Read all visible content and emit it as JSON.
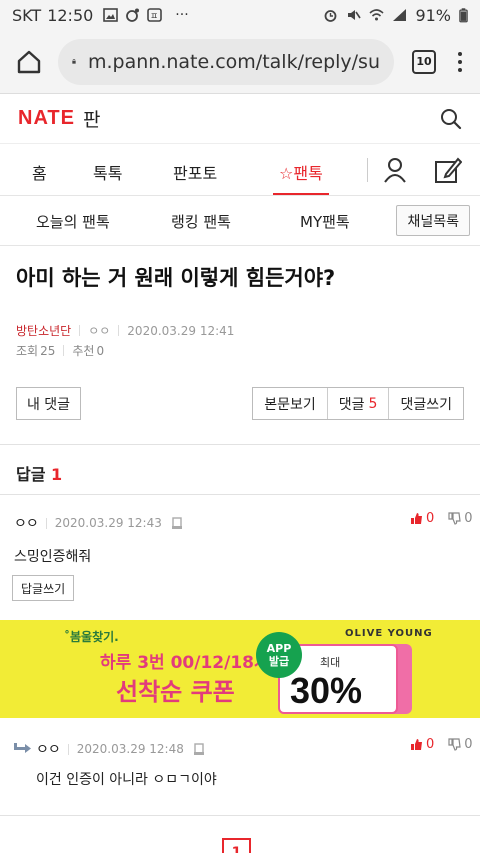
{
  "status_bar": {
    "carrier": "SKT",
    "time": "12:50",
    "battery": "91%",
    "left_icons": [
      "image-icon",
      "sync-icon",
      "app-icon",
      "more-dots"
    ],
    "right_icons": [
      "alarm-icon",
      "mute-icon",
      "wifi-icon",
      "signal-icon",
      "battery-icon"
    ],
    "more": "···"
  },
  "browser": {
    "url": "m.pann.nate.com/talk/reply/su",
    "tab_count": "10"
  },
  "site": {
    "logo": "NATE",
    "section": "판"
  },
  "main_nav": [
    "홈",
    "톡톡",
    "판포토",
    "팬톡"
  ],
  "sub_nav": [
    "오늘의 팬톡",
    "랭킹 팬톡",
    "MY팬톡"
  ],
  "channel_button": "채널목록",
  "post": {
    "title": "아미 하는 거 원래 이렇게 힘든거야?",
    "author": "방탄소년단",
    "nickname": "ㅇㅇ",
    "date": "2020.03.29 12:41",
    "views_label": "조회",
    "views": "25",
    "likes_label": "추천",
    "likes": "0"
  },
  "actions": {
    "my_comments": "내 댓글",
    "view_body": "본문보기",
    "comments_label": "댓글",
    "comments_count": "5",
    "write_comment": "댓글쓰기"
  },
  "reply_section": {
    "label": "답글",
    "count": "1"
  },
  "comments": [
    {
      "author": "ㅇㅇ",
      "date": "2020.03.29 12:43",
      "text": "스밍인증해줘",
      "up": "0",
      "down": "0",
      "reply_button": "답글쓰기"
    },
    {
      "author": "ㅇㅇ",
      "date": "2020.03.29 12:48",
      "text": "이건 인증이 아니라 ㅇㅁㄱ이야",
      "up": "0",
      "down": "0"
    }
  ],
  "ad": {
    "tag": "˚봄울찾기.",
    "line1": "하루 3번 00/12/18시!",
    "line2": "선착순 쿠폰",
    "brand": "OLIVE YOUNG",
    "app_badge_1": "APP",
    "app_badge_2": "발급",
    "max_label": "최대",
    "percent": "30%",
    "colors": {
      "background": "#f2ec36",
      "accent": "#e23b7c",
      "badge": "#16a24f"
    }
  },
  "pagination": {
    "current": "1"
  },
  "colors": {
    "brand_red": "#e8262c"
  }
}
